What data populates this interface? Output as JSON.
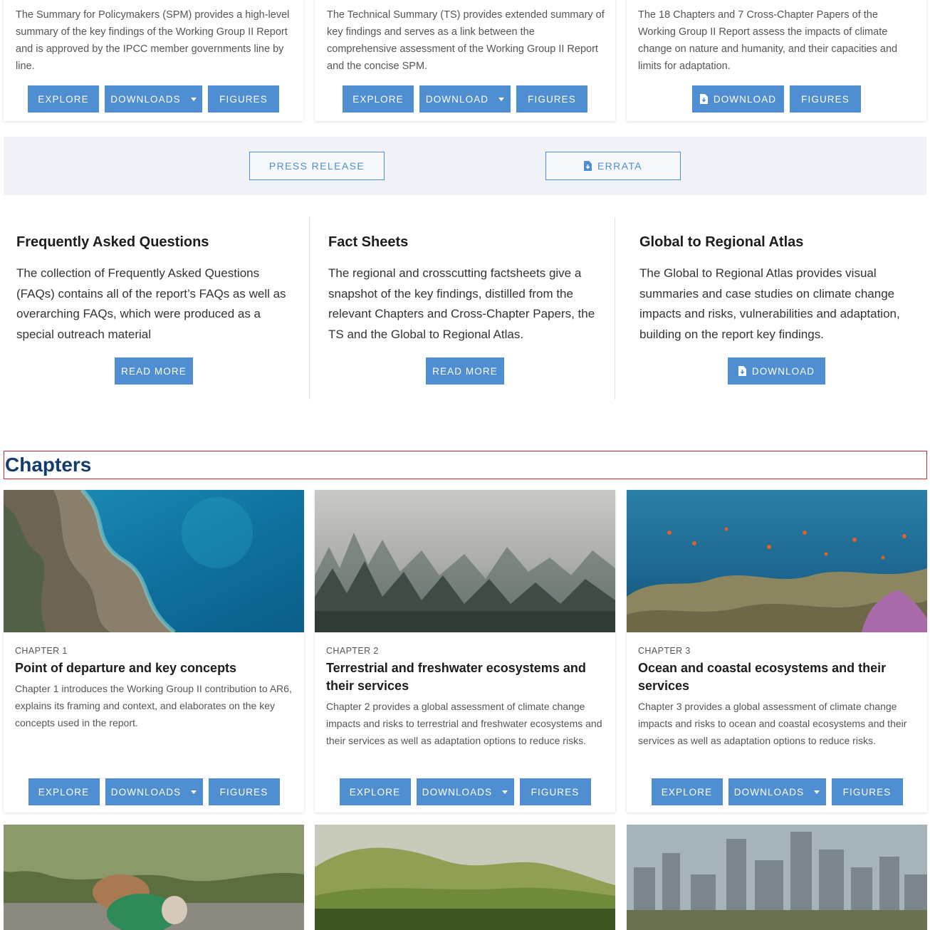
{
  "top_cards": [
    {
      "description": "The Summary for Policymakers (SPM) provides a high-level summary of the key findings of the Working Group II Report and is approved by the IPCC member governments line by line.",
      "buttons": [
        "EXPLORE",
        "DOWNLOADS",
        "FIGURES"
      ]
    },
    {
      "description": "The Technical Summary (TS) provides extended summary of key findings and serves as a link between the comprehensive assessment of the Working Group II Report and the concise SPM.",
      "buttons": [
        "EXPLORE",
        "DOWNLOAD",
        "FIGURES"
      ]
    },
    {
      "description": "The 18 Chapters and 7 Cross-Chapter Papers of the Working Group II Report assess the impacts of climate change on nature and humanity, and their capacities and limits for adaptation.",
      "buttons": [
        "DOWNLOAD",
        "FIGURES"
      ]
    }
  ],
  "band": {
    "press_release": "PRESS RELEASE",
    "errata": "ERRATA"
  },
  "info": [
    {
      "title": "Frequently Asked Questions",
      "text": "The collection of Frequently Asked Questions (FAQs) contains all of the report’s FAQs as well as overarching FAQs, which were produced as a special outreach material",
      "button": "READ MORE"
    },
    {
      "title": "Fact Sheets",
      "text": "The regional and crosscutting factsheets give a snapshot of the key findings, distilled from the relevant Chapters and Cross-Chapter Papers, the TS and the Global to Regional Atlas.",
      "button": "READ MORE"
    },
    {
      "title": "Global to Regional Atlas",
      "text": "The Global to Regional Atlas provides visual summaries and case studies on climate change impacts and risks, vulnerabilities and adaptation, building on the report key findings.",
      "button": "DOWNLOAD"
    }
  ],
  "chapters_heading": "Chapters",
  "chapters": [
    {
      "label": "CHAPTER 1",
      "title": "Point of departure and key concepts",
      "description": "Chapter 1 introduces the Working Group II contribution to AR6, explains its framing and context, and elaborates on the key concepts used in the report.",
      "buttons": [
        "EXPLORE",
        "DOWNLOADS",
        "FIGURES"
      ]
    },
    {
      "label": "CHAPTER 2",
      "title": "Terrestrial and freshwater ecosystems and their services",
      "description": "Chapter 2 provides a global assessment of climate change impacts and risks to terrestrial and freshwater ecosystems and their services as well as adaptation options to reduce risks.",
      "buttons": [
        "EXPLORE",
        "DOWNLOADS",
        "FIGURES"
      ]
    },
    {
      "label": "CHAPTER 3",
      "title": "Ocean and coastal ecosystems and their services",
      "description": "Chapter 3 provides a global assessment of climate change impacts and risks to ocean and coastal ecosystems and their services as well as adaptation options to reduce risks.",
      "buttons": [
        "EXPLORE",
        "DOWNLOADS",
        "FIGURES"
      ]
    }
  ],
  "colors": {
    "accent": "#4f8fd1",
    "heading": "#143c6b",
    "band": "#f1f3f8",
    "focus_outline": "#d9262c"
  }
}
